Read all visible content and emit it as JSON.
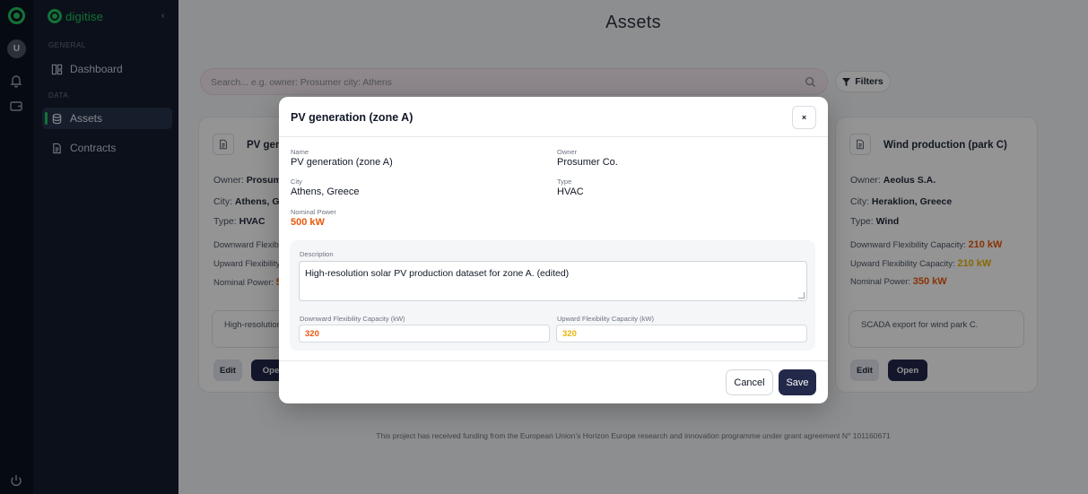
{
  "app": {
    "brand": "digitise",
    "avatar_initial": "U"
  },
  "sidebar": {
    "section_general": "GENERAL",
    "section_data": "DATA",
    "items": [
      {
        "label": "Dashboard",
        "icon": "dashboard-icon"
      },
      {
        "label": "Assets",
        "icon": "database-icon",
        "active": true
      },
      {
        "label": "Contracts",
        "icon": "document-icon"
      }
    ]
  },
  "page": {
    "title": "Assets",
    "search_placeholder": "Search... e.g. owner: Prosumer city: Athens",
    "filters_label": "Filters",
    "footer": "This project has received funding from the European Union’s Horizon Europe research and innovation programme under grant agreement N° 101160671"
  },
  "cards": [
    {
      "title": "PV gen",
      "owner_label": "Owner:",
      "owner": "Prosume",
      "city_label": "City:",
      "city": "Athens, Gr",
      "type_label": "Type:",
      "type": "HVAC",
      "down_label": "Downward Flexibility",
      "up_label": "Upward Flexibility",
      "nominal_label": "Nominal Power:",
      "nominal_value": "5",
      "description": "High-resolution dataset for zon",
      "edit_label": "Edit",
      "open_label": "Ope"
    },
    {
      "title": "Wind production (park C)",
      "owner_label": "Owner:",
      "owner": "Aeolus S.A.",
      "city_label": "City:",
      "city": "Heraklion, Greece",
      "type_label": "Type:",
      "type": "Wind",
      "down_label": "Downward Flexibility Capacity:",
      "down_value": "210 kW",
      "up_label": "Upward Flexibility Capacity:",
      "up_value": "210 kW",
      "nominal_label": "Nominal Power:",
      "nominal_value": "350 kW",
      "description": "SCADA export for wind park C.",
      "edit_label": "Edit",
      "open_label": "Open"
    }
  ],
  "modal": {
    "title": "PV generation (zone A)",
    "close_label": "×",
    "name_label": "Name",
    "name_value": "PV generation (zone A)",
    "owner_label": "Owner",
    "owner_value": "Prosumer Co.",
    "city_label": "City",
    "city_value": "Athens, Greece",
    "type_label": "Type",
    "type_value": "HVAC",
    "power_label": "Nominal Power",
    "power_value": "500 kW",
    "description_label": "Description",
    "description_value": "High-resolution solar PV production dataset for zone A. (edited)",
    "down_label": "Downward Flexibility Capacity (kW)",
    "down_value": "320",
    "up_label": "Upward Flexibility Capacity (kW)",
    "up_value": "320",
    "cancel_label": "Cancel",
    "save_label": "Save"
  },
  "colors": {
    "accent_green": "#22c55e",
    "primary_button": "#23294a",
    "value_orange": "#ea580c",
    "value_yellow": "#eab308"
  }
}
